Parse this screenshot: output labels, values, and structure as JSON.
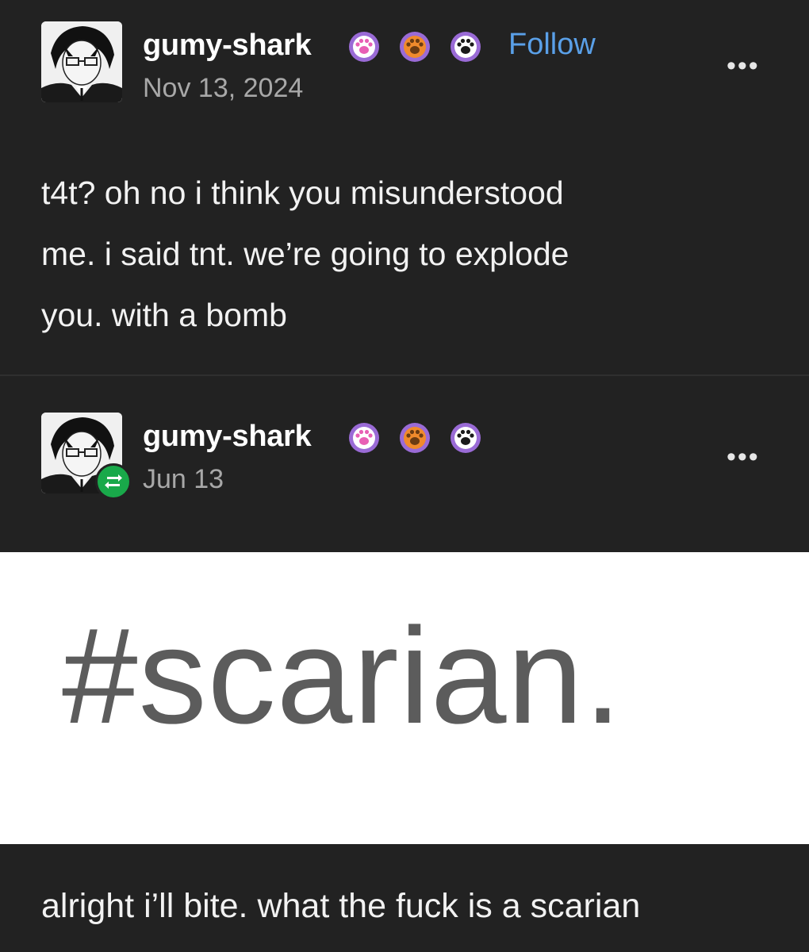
{
  "post1": {
    "username": "gumy-shark",
    "follow_label": "Follow",
    "date": "Nov 13, 2024",
    "more_label": "•••",
    "body_lines": [
      "t4t? oh no i think you misunderstood",
      "me. i said tnt. we’re going to explode",
      "you. with a bomb"
    ]
  },
  "post2": {
    "username": "gumy-shark",
    "date": "Jun 13",
    "more_label": "•••",
    "image_text": "#scarian."
  },
  "post3": {
    "body": "alright i’ll bite. what the fuck is a scarian"
  },
  "badges": [
    {
      "name": "pink-paw-badge",
      "ring": "#9a6bd6",
      "paw": "#e85fb5",
      "fill": "#ffffff"
    },
    {
      "name": "orange-paw-badge",
      "ring": "#9a6bd6",
      "paw": "#6b3b12",
      "fill": "#f08a2c"
    },
    {
      "name": "black-paw-badge",
      "ring": "#9a6bd6",
      "paw": "#1a1a1a",
      "fill": "#ffffff"
    }
  ],
  "colors": {
    "background": "#222222",
    "follow_link": "#5aa0e8",
    "reblog_green": "#19a94a",
    "hashtag_gray": "#5c5c5c"
  }
}
